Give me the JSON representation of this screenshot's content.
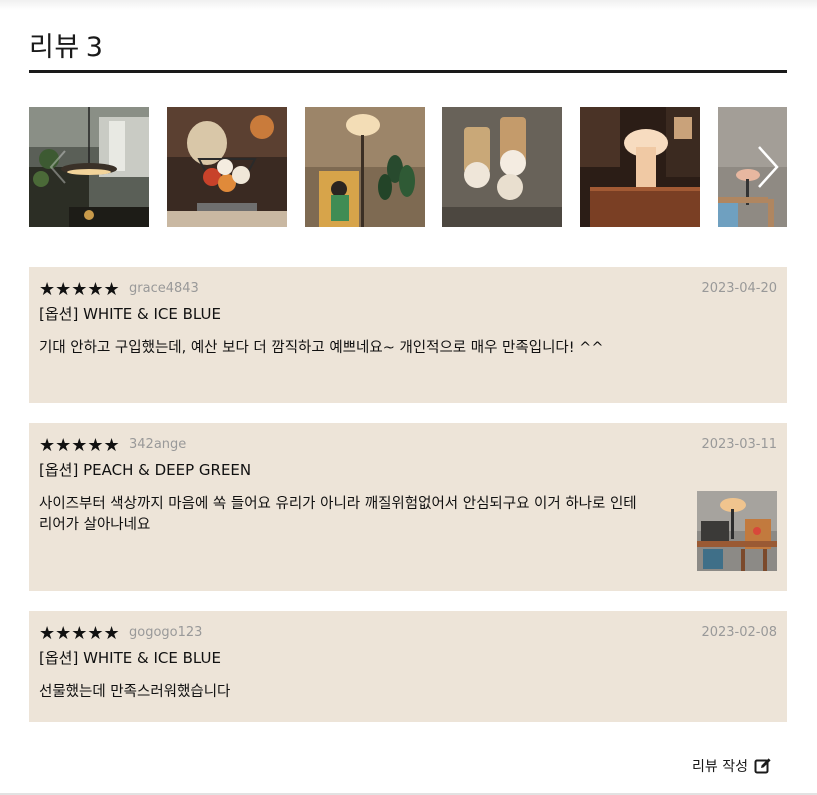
{
  "header": {
    "title": "리뷰",
    "count": "3"
  },
  "gallery": {
    "images": [
      {
        "name": "pendant-lamp-photo"
      },
      {
        "name": "fruit-basket-photo"
      },
      {
        "name": "floor-lamp-photo"
      },
      {
        "name": "wall-lamps-photo"
      },
      {
        "name": "mushroom-lamp-photo"
      },
      {
        "name": "desk-lamp-photo"
      }
    ],
    "prev_icon": "chevron-left-icon",
    "next_icon": "chevron-right-icon"
  },
  "reviews": [
    {
      "stars": "★★★★★",
      "rating": 5,
      "user": "grace4843",
      "date": "2023-04-20",
      "option": "[옵션] WHITE & ICE BLUE",
      "content": "기대 안하고 구입했는데, 예산 보다 더 깜직하고 예쁘네요~ 개인적으로 매우 만족입니다! ^^"
    },
    {
      "stars": "★★★★★",
      "rating": 5,
      "user": "342ange",
      "date": "2023-03-11",
      "option": "[옵션] PEACH & DEEP GREEN",
      "content": "사이즈부터 색상까지 마음에 쏙 들어요 유리가 아니라 깨질위험없어서 안심되구요 이거 하나로 인테리어가 살아나네요",
      "has_photo": true
    },
    {
      "stars": "★★★★★",
      "rating": 5,
      "user": "gogogo123",
      "date": "2023-02-08",
      "option": "[옵션] WHITE & ICE BLUE",
      "content": "선물했는데 만족스러워했습니다"
    }
  ],
  "actions": {
    "write_label": "리뷰 작성",
    "write_icon": "edit-icon"
  },
  "colors": {
    "review_bg": "#ede4d8",
    "meta_text": "#999999",
    "title_rule": "#1a1a1a"
  }
}
